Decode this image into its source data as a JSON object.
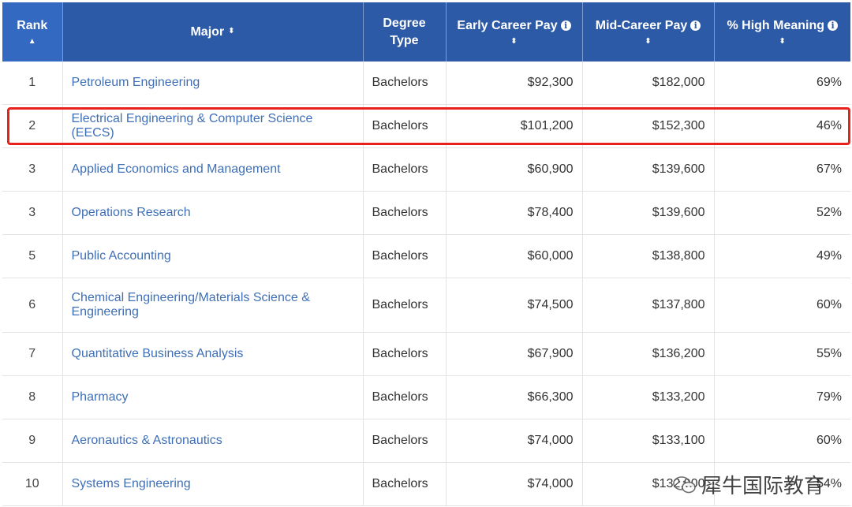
{
  "table": {
    "columns": [
      {
        "label": "Rank",
        "sort": "▲"
      },
      {
        "label": "Major",
        "sort": "⬍"
      },
      {
        "label_line1": "Degree",
        "label_line2": "Type"
      },
      {
        "label": "Early Career Pay",
        "info": "i",
        "sort": "⬍"
      },
      {
        "label": "Mid-Career Pay",
        "info": "i",
        "sort": "⬍"
      },
      {
        "label": "% High Meaning",
        "info": "i",
        "sort": "⬍"
      }
    ],
    "rows": [
      {
        "rank": "1",
        "major": "Petroleum Engineering",
        "degree": "Bachelors",
        "early": "$92,300",
        "mid": "$182,000",
        "meaning": "69%"
      },
      {
        "rank": "2",
        "major": "Electrical Engineering & Computer Science (EECS)",
        "degree": "Bachelors",
        "early": "$101,200",
        "mid": "$152,300",
        "meaning": "46%"
      },
      {
        "rank": "3",
        "major": "Applied Economics and Management",
        "degree": "Bachelors",
        "early": "$60,900",
        "mid": "$139,600",
        "meaning": "67%"
      },
      {
        "rank": "3",
        "major": "Operations Research",
        "degree": "Bachelors",
        "early": "$78,400",
        "mid": "$139,600",
        "meaning": "52%"
      },
      {
        "rank": "5",
        "major": "Public Accounting",
        "degree": "Bachelors",
        "early": "$60,000",
        "mid": "$138,800",
        "meaning": "49%"
      },
      {
        "rank": "6",
        "major": "Chemical Engineering/Materials Science & Engineering",
        "degree": "Bachelors",
        "early": "$74,500",
        "mid": "$137,800",
        "meaning": "60%"
      },
      {
        "rank": "7",
        "major": "Quantitative Business Analysis",
        "degree": "Bachelors",
        "early": "$67,900",
        "mid": "$136,200",
        "meaning": "55%"
      },
      {
        "rank": "8",
        "major": "Pharmacy",
        "degree": "Bachelors",
        "early": "$66,300",
        "mid": "$133,200",
        "meaning": "79%"
      },
      {
        "rank": "9",
        "major": "Aeronautics & Astronautics",
        "degree": "Bachelors",
        "early": "$74,000",
        "mid": "$133,100",
        "meaning": "60%"
      },
      {
        "rank": "10",
        "major": "Systems Engineering",
        "degree": "Bachelors",
        "early": "$74,000",
        "mid": "$132,900",
        "meaning": "54%"
      }
    ]
  },
  "watermark": {
    "text": "犀牛国际教育",
    "icon": "wechat-icon"
  },
  "colors": {
    "header": "#2c5aa7",
    "link": "#3f6fb6",
    "highlight": "#e8211d"
  }
}
